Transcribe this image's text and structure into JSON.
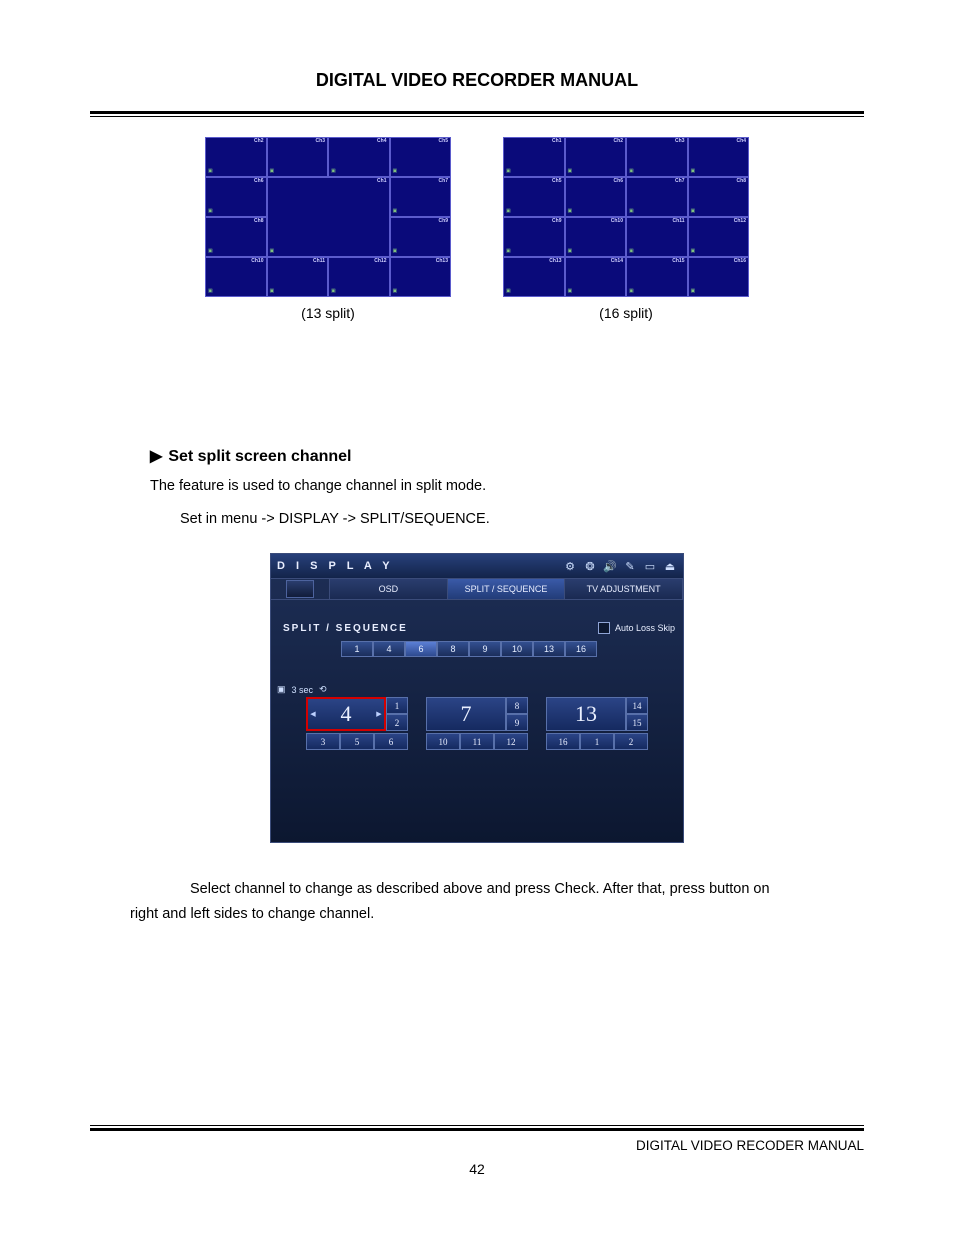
{
  "header": {
    "title": "DIGITAL VIDEO RECORDER MANUAL"
  },
  "splits": {
    "left": {
      "caption": "(13 split)",
      "labels": [
        "Ch2",
        "Ch3",
        "Ch4",
        "Ch5",
        "Ch6",
        "Ch7",
        "Ch8",
        "Ch9",
        "Ch10",
        "Ch11",
        "Ch12",
        "Ch13",
        "Ch1"
      ]
    },
    "right": {
      "caption": "(16 split)",
      "labels": [
        "Ch1",
        "Ch2",
        "Ch3",
        "Ch4",
        "Ch5",
        "Ch6",
        "Ch7",
        "Ch8",
        "Ch9",
        "Ch10",
        "Ch11",
        "Ch12",
        "Ch13",
        "Ch14",
        "Ch15",
        "Ch16"
      ]
    }
  },
  "section": {
    "sym": "▶",
    "head": "Set split screen channel",
    "p1": "The feature is used to change channel in split mode.",
    "p2": "Set in menu -> DISPLAY -> SPLIT/SEQUENCE.",
    "after1": "Select channel to change as described above and press Check. After that, press button on",
    "after2": "right and left sides to change channel."
  },
  "display": {
    "title": "D I S P L A Y",
    "tabs": {
      "osd": "OSD",
      "split": "SPLIT / SEQUENCE",
      "tv": "TV ADJUSTMENT"
    },
    "sub_label": "SPLIT / SEQUENCE",
    "auto_loss": "Auto Loss Skip",
    "nums": [
      "1",
      "4",
      "6",
      "8",
      "9",
      "10",
      "13",
      "16"
    ],
    "selected_num": "6",
    "sidebar_time": "3 sec",
    "panels": [
      {
        "main": "4",
        "highlight": true,
        "side": [
          "1",
          "2"
        ],
        "bottom": [
          "3",
          "5",
          "6"
        ]
      },
      {
        "main": "7",
        "highlight": false,
        "side": [
          "8",
          "9"
        ],
        "bottom": [
          "10",
          "11",
          "12"
        ]
      },
      {
        "main": "13",
        "highlight": false,
        "side": [
          "14",
          "15"
        ],
        "bottom": [
          "16",
          "1",
          "2"
        ]
      }
    ]
  },
  "footer": {
    "text": "DIGITAL VIDEO RECODER MANUAL",
    "page": "42"
  }
}
